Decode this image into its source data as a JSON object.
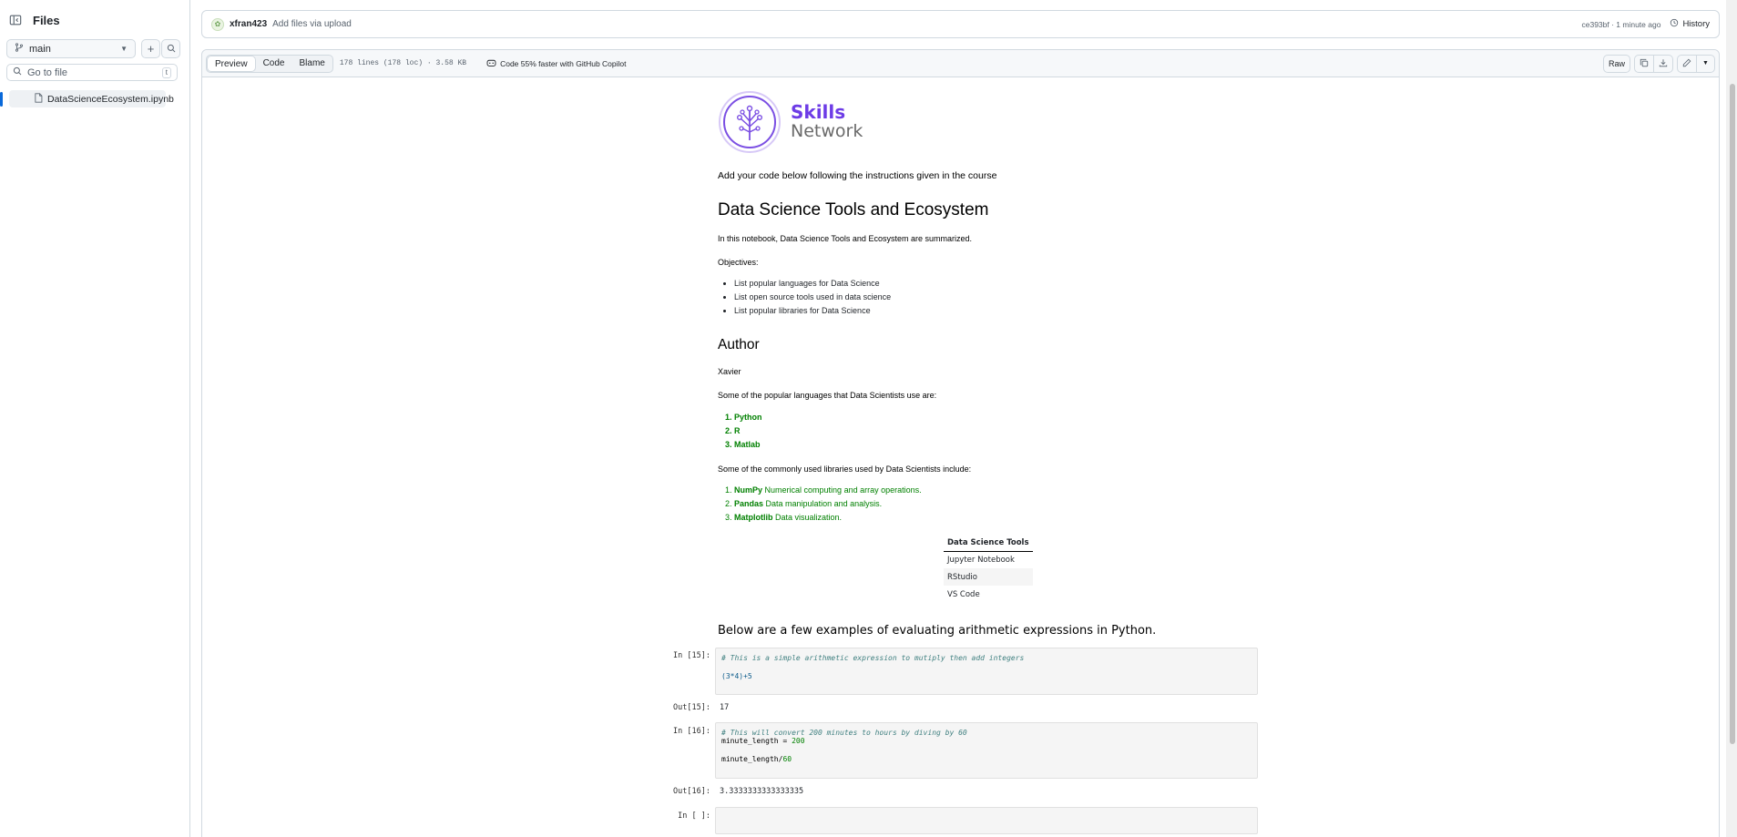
{
  "sidebar": {
    "title": "Files",
    "branch": "main",
    "goto_placeholder": "Go to file",
    "goto_shortcut": "t",
    "files": [
      "DataScienceEcosystem.ipynb"
    ]
  },
  "commit": {
    "user": "xfran423",
    "message": "Add files via upload",
    "meta": "ce393bf · 1 minute ago",
    "history_label": "History"
  },
  "toolbar": {
    "tabs": [
      "Preview",
      "Code",
      "Blame"
    ],
    "active_tab": "Preview",
    "file_info": "178 lines (178 loc) · 3.58 KB",
    "copilot": "Code 55% faster with GitHub Copilot",
    "raw_label": "Raw"
  },
  "notebook": {
    "logo_line1": "Skills",
    "logo_line2": "Network",
    "intro": "Add your code below following the instructions given in the course",
    "h1": "Data Science Tools and Ecosystem",
    "summary": "In this notebook, Data Science Tools and Ecosystem are summarized.",
    "objectives_label": "Objectives:",
    "objectives": [
      "List popular languages for Data Science",
      "List open source tools used in data science",
      "List popular libraries for Data Science"
    ],
    "author_heading": "Author",
    "author": "Xavier",
    "languages_intro": "Some of the popular languages that Data Scientists use are:",
    "languages": [
      "Python",
      "R",
      "Matlab"
    ],
    "libraries_intro": "Some of the commonly used libraries used by Data Scientists include:",
    "libraries": [
      {
        "name": "NumPy",
        "desc": "Numerical computing and array operations."
      },
      {
        "name": "Pandas",
        "desc": "Data manipulation and analysis."
      },
      {
        "name": "Matplotlib",
        "desc": "Data visualization."
      }
    ],
    "table_header": "Data Science Tools",
    "table_rows": [
      "Jupyter Notebook",
      "RStudio",
      "VS Code"
    ],
    "examples_heading": "Below are a few examples of evaluating arithmetic expressions in Python.",
    "cells": [
      {
        "in_prompt": "In [15]:",
        "comment": "# This is a simple arithmetic expression to mutiply then add integers",
        "code": "(3*4)+5",
        "out_prompt": "Out[15]:",
        "output": "17"
      },
      {
        "in_prompt": "In [16]:",
        "comment": "# This will convert 200 minutes to hours by diving by 60",
        "code1": "minute_length = ",
        "code1_num": "200",
        "code2": "minute_length/",
        "code2_num": "60",
        "out_prompt": "Out[16]:",
        "output": "3.3333333333333335"
      },
      {
        "in_prompt": "In [ ]:"
      }
    ]
  }
}
